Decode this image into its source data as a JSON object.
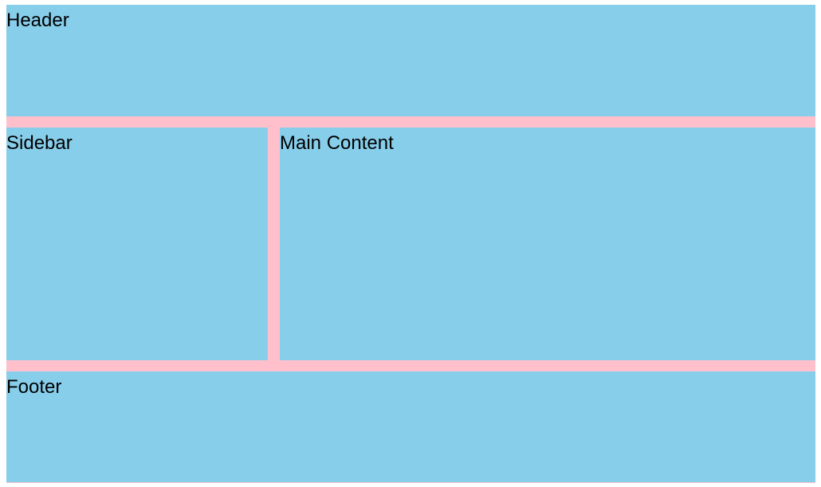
{
  "colors": {
    "cell_background": "#87ceeb",
    "gap_background": "#ffc0cb",
    "text": "#000000"
  },
  "header": {
    "label": "Header"
  },
  "sidebar": {
    "label": "Sidebar"
  },
  "main": {
    "label": "Main Content"
  },
  "footer": {
    "label": "Footer"
  }
}
